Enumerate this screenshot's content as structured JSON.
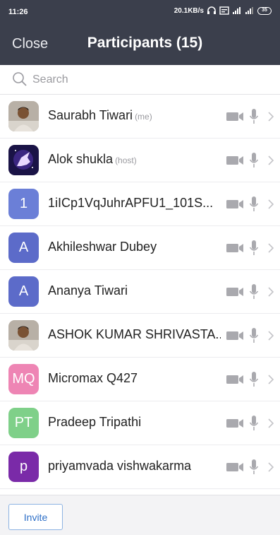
{
  "status_bar": {
    "time": "11:26",
    "network_speed": "20.1KB/s",
    "battery": "35"
  },
  "header": {
    "close_label": "Close",
    "title": "Participants (15)"
  },
  "search": {
    "placeholder": "Search"
  },
  "participants": [
    {
      "name": "Saurabh Tiwari",
      "tag": "(me)",
      "avatar_type": "photo",
      "avatar_icon": "person-photo"
    },
    {
      "name": "Alok shukla",
      "tag": "(host)",
      "avatar_type": "photo",
      "avatar_icon": "unicorn-photo"
    },
    {
      "name": "1iICp1VqJuhrAPFU1_101S...",
      "tag": "",
      "avatar_type": "initials",
      "initials": "1",
      "color": "#6b7fd7"
    },
    {
      "name": "Akhileshwar Dubey",
      "tag": "",
      "avatar_type": "initials",
      "initials": "A",
      "color": "#5c6bc9"
    },
    {
      "name": "Ananya Tiwari",
      "tag": "",
      "avatar_type": "initials",
      "initials": "A",
      "color": "#5c6bc9"
    },
    {
      "name": "ASHOK KUMAR SHRIVASTA...",
      "tag": "",
      "avatar_type": "photo",
      "avatar_icon": "person-photo"
    },
    {
      "name": "Micromax Q427",
      "tag": "",
      "avatar_type": "initials",
      "initials": "MQ",
      "color": "#ee85b4"
    },
    {
      "name": "Pradeep Tripathi",
      "tag": "",
      "avatar_type": "initials",
      "initials": "PT",
      "color": "#7fd089"
    },
    {
      "name": "priyamvada vishwakarma",
      "tag": "",
      "avatar_type": "initials",
      "initials": "p",
      "color": "#7a2aa8"
    }
  ],
  "row_icons": [
    "video-camera-icon",
    "microphone-icon",
    "chevron-right-icon"
  ],
  "footer": {
    "invite_label": "Invite"
  },
  "colors": {
    "header_bg": "#3b3f4c",
    "icon_gray": "#a9a9ae",
    "invite_blue": "#2d6fc7"
  }
}
